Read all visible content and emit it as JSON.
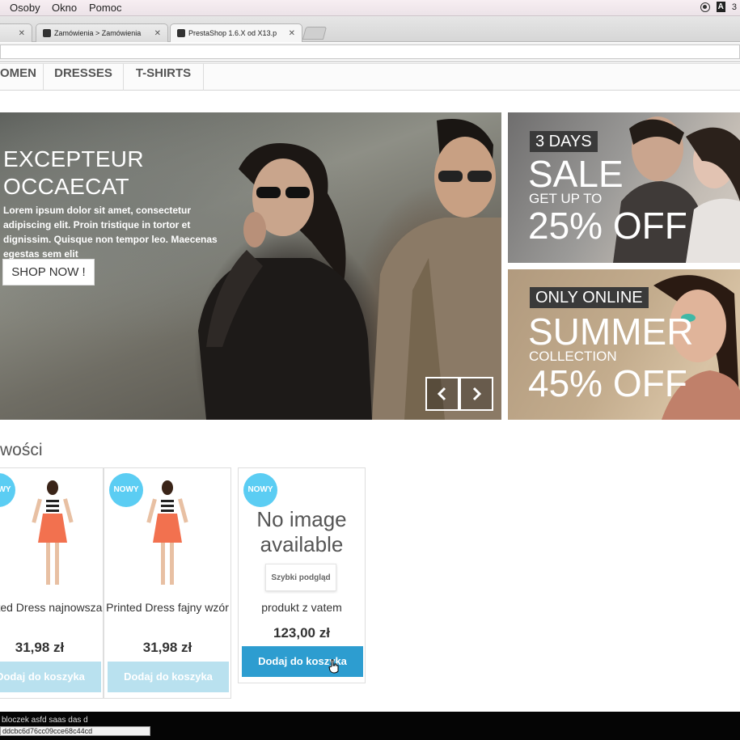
{
  "menubar": {
    "items": [
      "Osoby",
      "Okno",
      "Pomoc"
    ],
    "tray_badge": "3"
  },
  "browser": {
    "tabs": [
      {
        "label": ""
      },
      {
        "label": "Zamówienia > Zamówienia"
      },
      {
        "label": "PrestaShop 1.6.X od X13.p"
      }
    ],
    "url": ""
  },
  "nav": {
    "items": [
      "OMEN",
      "DRESSES",
      "T-SHIRTS"
    ]
  },
  "hero": {
    "title_line1": "EXCEPTEUR",
    "title_line2": "OCCAECAT",
    "text": "Lorem ipsum dolor sit amet, consectetur adipiscing elit. Proin tristique in tortor et dignissim. Quisque non tempor leo. Maecenas egestas sem elit",
    "button": "SHOP NOW !"
  },
  "banners": [
    {
      "tag": "3 DAYS",
      "headline": "SALE",
      "sub": "GET UP TO",
      "offer": "25% OFF"
    },
    {
      "tag": "ONLY ONLINE",
      "headline": "SUMMER",
      "sub": "COLLECTION",
      "offer": "45% OFF"
    }
  ],
  "products_section": {
    "title": "wości",
    "products": [
      {
        "badge": "NOWY",
        "name": "Printed Dress najnowsza",
        "price": "31,98 zł",
        "button": "Dodaj do koszyka"
      },
      {
        "badge": "NOWY",
        "name": "Printed Dress fajny wzór",
        "price": "31,98 zł",
        "button": "Dodaj do koszyka"
      },
      {
        "badge": "NOWY",
        "no_image": "No image available",
        "quick_view": "Szybki podgląd",
        "name": "produkt z vatem",
        "price": "123,00 zł",
        "button": "Dodaj do koszyka"
      }
    ]
  },
  "footer": {
    "text": "bloczek asfd saas das d",
    "hash": "ddcbc6d76cc09cce68c44cd"
  },
  "colors": {
    "badge": "#5bcdf3",
    "cart_button": "#2d9dd0",
    "cart_button_faded": "#b9e1ef"
  }
}
